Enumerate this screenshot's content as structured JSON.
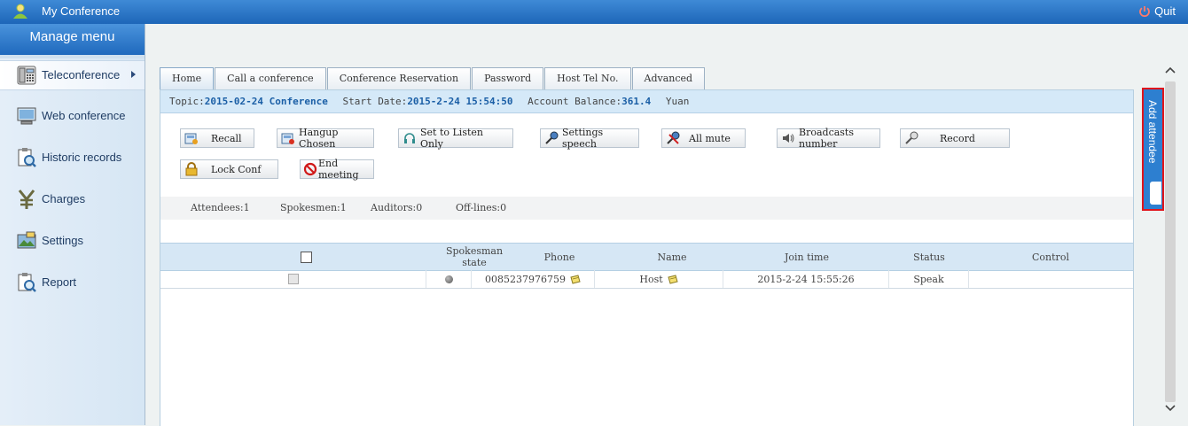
{
  "header": {
    "title": "My Conference",
    "quit_label": "Quit"
  },
  "sidebar": {
    "title": "Manage menu",
    "items": [
      {
        "label": "Teleconference",
        "icon": "phone-icon"
      },
      {
        "label": "Web conference",
        "icon": "computer-icon"
      },
      {
        "label": "Historic records",
        "icon": "magnifier-clipboard-icon"
      },
      {
        "label": "Charges",
        "icon": "yen-icon"
      },
      {
        "label": "Settings",
        "icon": "settings-picture-icon"
      },
      {
        "label": "Report",
        "icon": "report-icon"
      }
    ]
  },
  "tabs": [
    "Home",
    "Call a conference",
    "Conference Reservation",
    "Password",
    "Host Tel No.",
    "Advanced"
  ],
  "info": {
    "topic_label": "Topic:",
    "topic": "2015-02-24 Conference",
    "start_label": "Start Date:",
    "start": "2015-2-24 15:54:50",
    "balance_label": "Account Balance:",
    "balance": "361.4",
    "currency": "Yuan"
  },
  "buttons": {
    "recall": "Recall",
    "hangup": "Hangup Chosen",
    "listen": "Set to Listen Only",
    "speech": "Settings speech",
    "mute": "All mute",
    "broadcast": "Broadcasts number",
    "record": "Record",
    "lock": "Lock Conf",
    "end": "End meeting"
  },
  "stats": {
    "attendees": "Attendees:1",
    "spokesmen": "Spokesmen:1",
    "auditors": "Auditors:0",
    "offlines": "Off-lines:0"
  },
  "table": {
    "headers": {
      "spokesman_state": "Spokesman state",
      "phone": "Phone",
      "name": "Name",
      "join_time": "Join time",
      "status": "Status",
      "control": "Control"
    },
    "rows": [
      {
        "phone": "0085237976759",
        "name": "Host",
        "join_time": "2015-2-24 15:55:26",
        "status": "Speak",
        "control": ""
      }
    ]
  },
  "side_panel": {
    "label": "Add attendee"
  },
  "colors": {
    "header_blue": "#1d66b8",
    "accent_red": "#e0151c",
    "info_blue": "#1b5fa6"
  }
}
